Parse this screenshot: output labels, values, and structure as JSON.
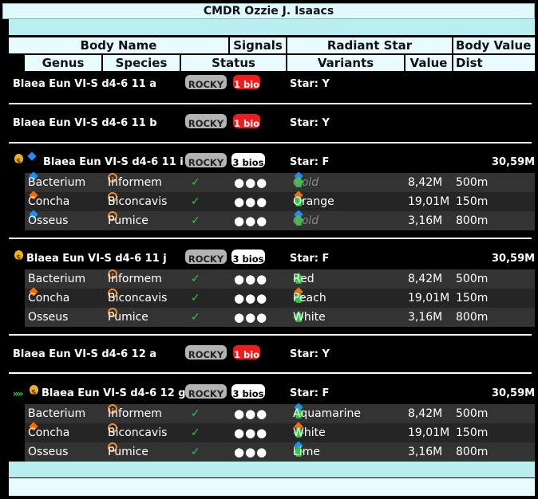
{
  "commander": "CMDR Ozzie J. Isaacs",
  "headers": {
    "row1": [
      "Body Name",
      "Signals",
      "Radiant Star",
      "Body Value"
    ],
    "row2": [
      "Genus",
      "Species",
      "Status",
      "Variants",
      "Value",
      "Dist"
    ]
  },
  "bodies": [
    {
      "name": "Blaea Eun VI-S d4-6 11 a",
      "type_tag": "ROCKY",
      "bio_tag": "1 bio",
      "bio_color": "red",
      "star": "Star: Y",
      "value": "",
      "prefix_icons": []
    },
    {
      "name": "Blaea Eun VI-S d4-6 11 b",
      "type_tag": "ROCKY",
      "bio_tag": "1 bio",
      "bio_color": "red",
      "star": "Star: Y",
      "value": "",
      "prefix_icons": []
    },
    {
      "name": "Blaea Eun VI-S d4-6 11 i",
      "type_tag": "ROCKY",
      "bio_tag": "3 bios",
      "bio_color": "white",
      "star": "Star: F",
      "value": "30,59M",
      "prefix_icons": [
        "moneybag-icon",
        "blue-diamond-icon"
      ],
      "species": [
        {
          "genus": "Bacterium",
          "genus_icon": "blue-diamond",
          "species": "Informem",
          "status": "✓",
          "dots": "●●●",
          "variant_icons": [
            "cross",
            "blue-diamond",
            "up-arrow"
          ],
          "variant": "Gold",
          "variant_muted": true,
          "value": "8,42M",
          "dist": "500m"
        },
        {
          "genus": "Concha",
          "genus_icon": "orange-diamond",
          "species": "Biconcavis",
          "status": "✓",
          "dots": "●●●",
          "variant_icons": [
            "check",
            "blue-diamond",
            "orange-diamond",
            "up-arrow"
          ],
          "variant": "Orange",
          "variant_muted": false,
          "value": "19,01M",
          "dist": "150m"
        },
        {
          "genus": "Osseus",
          "genus_icon": "blue-diamond",
          "species": "Pumice",
          "status": "✓",
          "dots": "●●●",
          "variant_icons": [
            "cross",
            "blue-diamond",
            "up-arrow"
          ],
          "variant": "Gold",
          "variant_muted": true,
          "value": "3,16M",
          "dist": "800m"
        }
      ]
    },
    {
      "name": "Blaea Eun VI-S d4-6 11 j",
      "type_tag": "ROCKY",
      "bio_tag": "3 bios",
      "bio_color": "white",
      "star": "Star: F",
      "value": "30,59M",
      "prefix_icons": [
        "moneybag-icon"
      ],
      "species": [
        {
          "genus": "Bacterium",
          "genus_icon": "",
          "species": "Informem",
          "status": "✓",
          "dots": "●●●",
          "variant_icons": [
            "check",
            "up-arrow"
          ],
          "variant": "Red",
          "variant_muted": false,
          "value": "8,42M",
          "dist": "500m"
        },
        {
          "genus": "Concha",
          "genus_icon": "orange-diamond",
          "species": "Biconcavis",
          "status": "✓",
          "dots": "●●●",
          "variant_icons": [
            "check",
            "blue-diamond",
            "orange-diamond",
            "up-arrow"
          ],
          "variant": "Peach",
          "variant_muted": false,
          "value": "19,01M",
          "dist": "150m"
        },
        {
          "genus": "Osseus",
          "genus_icon": "",
          "species": "Pumice",
          "status": "✓",
          "dots": "●●●",
          "variant_icons": [
            "check",
            "up-arrow"
          ],
          "variant": "White",
          "variant_muted": false,
          "value": "3,16M",
          "dist": "800m"
        }
      ]
    },
    {
      "name": "Blaea Eun VI-S d4-6 12 a",
      "type_tag": "ROCKY",
      "bio_tag": "1 bio",
      "bio_color": "red",
      "star": "Star: Y",
      "value": "",
      "prefix_icons": []
    },
    {
      "name": "Blaea Eun VI-S d4-6 12 g",
      "type_tag": "ROCKY",
      "bio_tag": "3 bios",
      "bio_color": "white",
      "star": "Star: F",
      "value": "30,59M",
      "prefix_icons": [
        "chevrons-icon",
        "moneybag-icon"
      ],
      "species": [
        {
          "genus": "Bacterium",
          "genus_icon": "",
          "species": "Informem",
          "status": "✓",
          "dots": "●●●",
          "variant_icons": [
            "check",
            "blue-diamond",
            "up-arrow"
          ],
          "variant": "Aquamarine",
          "variant_muted": false,
          "value": "8,42M",
          "dist": "500m"
        },
        {
          "genus": "Concha",
          "genus_icon": "orange-diamond",
          "species": "Biconcavis",
          "status": "✓",
          "dots": "●●●",
          "variant_icons": [
            "check",
            "blue-diamond",
            "orange-diamond",
            "up-arrow"
          ],
          "variant": "White",
          "variant_muted": false,
          "value": "19,01M",
          "dist": "150m"
        },
        {
          "genus": "Osseus",
          "genus_icon": "",
          "species": "Pumice",
          "status": "✓",
          "dots": "●●●",
          "variant_icons": [
            "check",
            "blue-diamond",
            "up-arrow"
          ],
          "variant": "Lime",
          "variant_muted": false,
          "value": "3,16M",
          "dist": "800m"
        }
      ]
    }
  ],
  "colors": {
    "blue": "#1a8fff",
    "orange": "#ff6a00",
    "green": "#2ecc40",
    "red": "#e53935",
    "header_bg": "#e8fbff",
    "band_bg": "#b9eef0"
  }
}
